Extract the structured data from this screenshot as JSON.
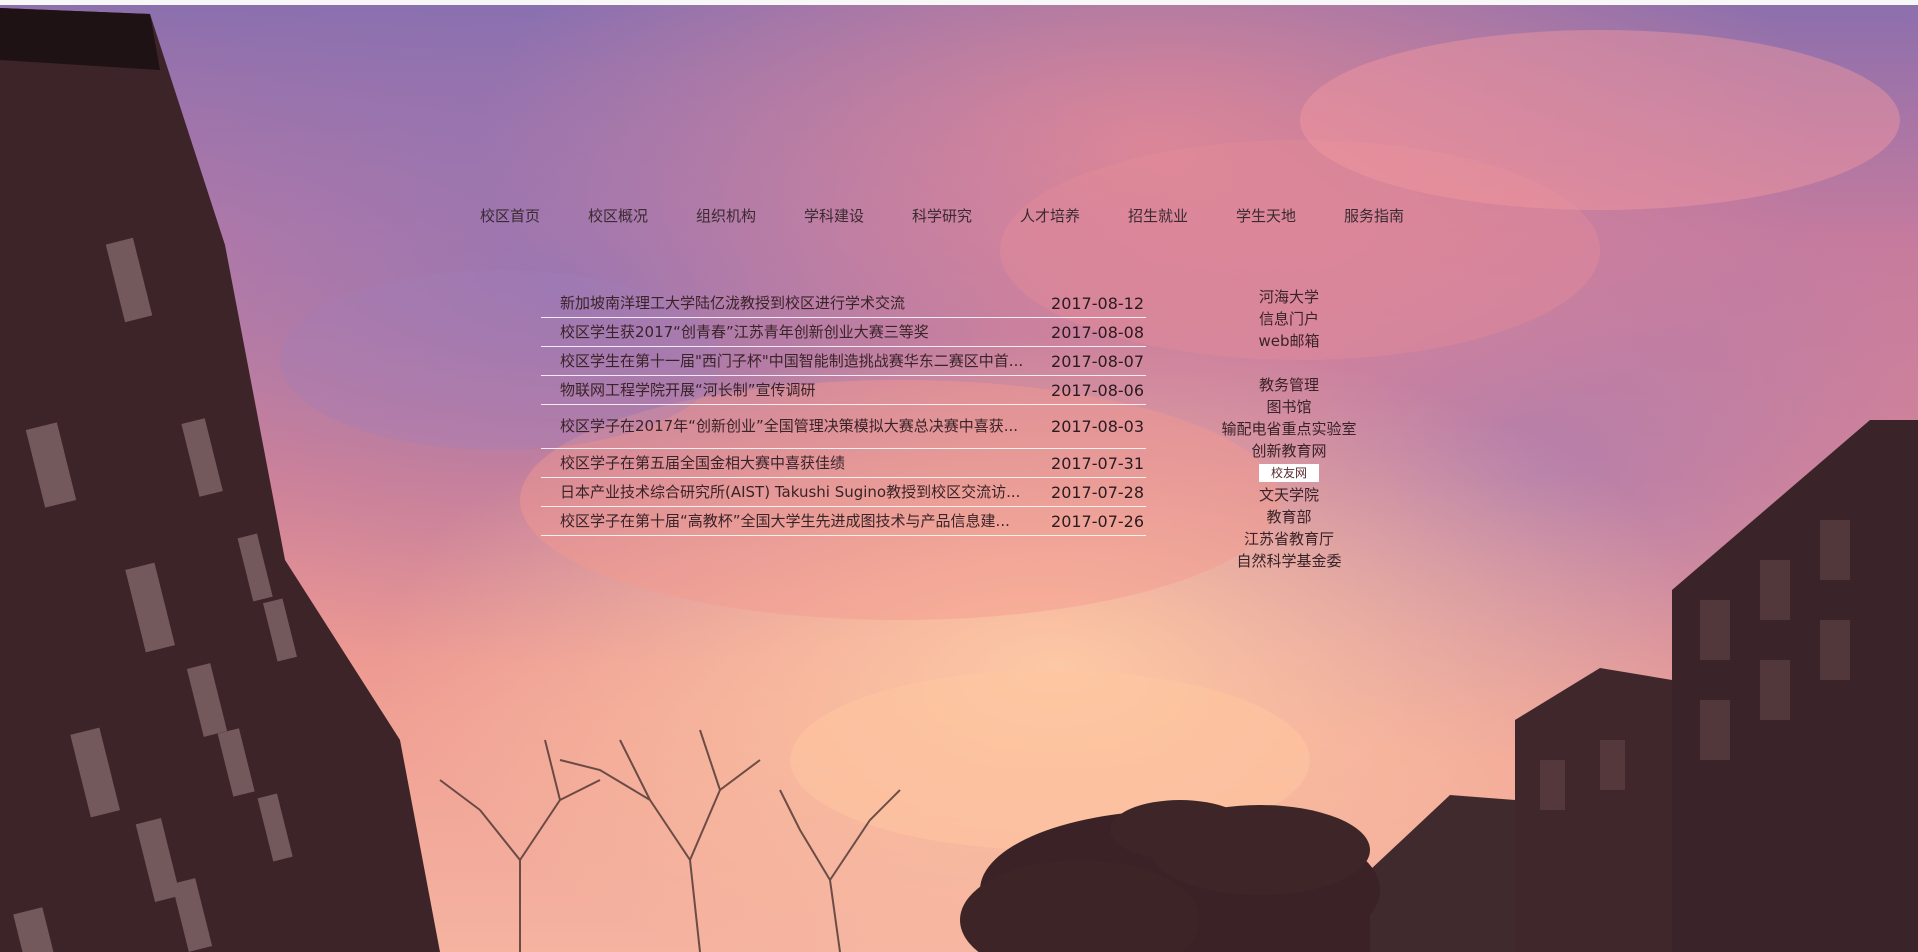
{
  "nav": {
    "items": [
      "校区首页",
      "校区概况",
      "组织机构",
      "学科建设",
      "科学研究",
      "人才培养",
      "招生就业",
      "学生天地",
      "服务指南"
    ]
  },
  "news": {
    "items": [
      {
        "title": "新加坡南洋理工大学陆亿泷教授到校区进行学术交流",
        "date": "2017-08-12"
      },
      {
        "title": "校区学生获2017“创青春”江苏青年创新创业大赛三等奖",
        "date": "2017-08-08"
      },
      {
        "title": "校区学生在第十一届\"西门子杯\"中国智能制造挑战赛华东二赛区中首...",
        "date": "2017-08-07"
      },
      {
        "title": "物联网工程学院开展“河长制”宣传调研",
        "date": "2017-08-06"
      },
      {
        "title": "校区学子在2017年“创新创业”全国管理决策模拟大赛总决赛中喜获...",
        "date": "2017-08-03"
      },
      {
        "title": "校区学子在第五届全国金相大赛中喜获佳绩",
        "date": "2017-07-31"
      },
      {
        "title": "日本产业技术综合研究所(AIST) Takushi Sugino教授到校区交流访...",
        "date": "2017-07-28"
      },
      {
        "title": "校区学子在第十届“高教杯”全国大学生先进成图技术与产品信息建...",
        "date": "2017-07-26"
      }
    ]
  },
  "links": {
    "group1": [
      "河海大学",
      "信息门户",
      "web邮箱"
    ],
    "group2": [
      "教务管理",
      "图书馆",
      "输配电省重点实验室",
      "创新教育网"
    ],
    "highlight": "校友网",
    "group3": [
      "文天学院",
      "教育部",
      "江苏省教育厅",
      "自然科学基金委"
    ]
  },
  "colors": {
    "sky_top": "#7d6fb0",
    "sky_mid": "#e07f8e",
    "sky_low": "#f4a29a",
    "building": "#3a2226",
    "text": "#3a2328"
  }
}
